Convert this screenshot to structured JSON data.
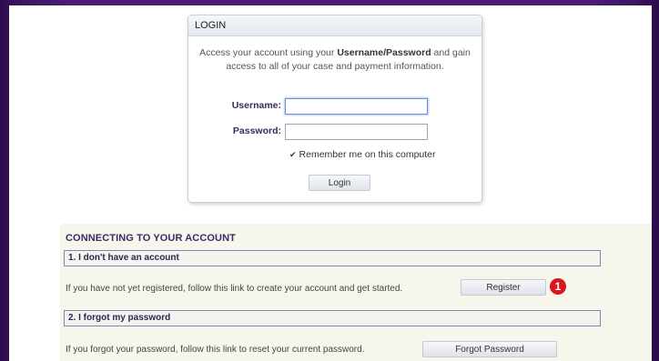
{
  "login": {
    "header": "LOGIN",
    "intro_prefix": "Access your account using your ",
    "intro_bold": "Username/Password",
    "intro_suffix": " and gain access to all of your case and payment information.",
    "username_label": "Username:",
    "username_value": "",
    "password_label": "Password:",
    "password_value": "",
    "remember_label": "Remember me on this computer",
    "remember_checked": true,
    "login_button": "Login"
  },
  "connecting": {
    "title": "CONNECTING TO YOUR ACCOUNT",
    "steps": [
      {
        "heading": "1. I don't have an account",
        "text": "If you have not yet registered, follow this link to create your account and get started.",
        "button": "Register"
      },
      {
        "heading": "2. I forgot my password",
        "text": "If you forgot your password, follow this link to reset your current password.",
        "button": "Forgot Password"
      }
    ],
    "callout_number": "1"
  },
  "colors": {
    "background": "#4a1c74",
    "heading": "#3b2a6b",
    "callout": "#d9161e"
  }
}
